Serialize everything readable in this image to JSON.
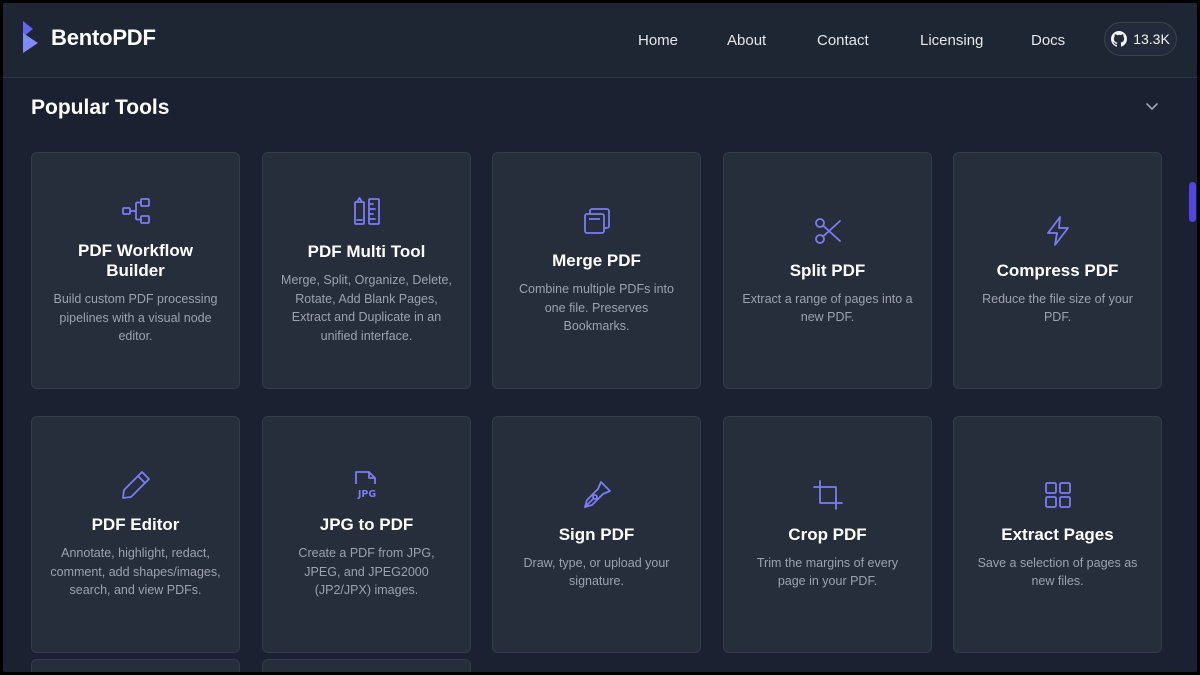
{
  "header": {
    "brand": "BentoPDF",
    "nav": [
      "Home",
      "About",
      "Contact",
      "Licensing",
      "Docs"
    ],
    "github_stars": "13.3K"
  },
  "section": {
    "title": "Popular Tools"
  },
  "tools": [
    {
      "icon": "workflow-icon",
      "title": "PDF Workflow Builder",
      "desc": "Build custom PDF processing pipelines with a visual node editor."
    },
    {
      "icon": "pencil-ruler-icon",
      "title": "PDF Multi Tool",
      "desc": "Merge, Split, Organize, Delete, Rotate, Add Blank Pages, Extract and Duplicate in an unified interface."
    },
    {
      "icon": "copy-icon",
      "title": "Merge PDF",
      "desc": "Combine multiple PDFs into one file. Preserves Bookmarks."
    },
    {
      "icon": "scissors-icon",
      "title": "Split PDF",
      "desc": "Extract a range of pages into a new PDF."
    },
    {
      "icon": "zap-icon",
      "title": "Compress PDF",
      "desc": "Reduce the file size of your PDF."
    },
    {
      "icon": "pencil-icon",
      "title": "PDF Editor",
      "desc": "Annotate, highlight, redact, comment, add shapes/images, search, and view PDFs."
    },
    {
      "icon": "jpg-file-icon",
      "title": "JPG to PDF",
      "desc": "Create a PDF from JPG, JPEG, and JPEG2000 (JP2/JPX) images.",
      "badge": "JPG"
    },
    {
      "icon": "pen-tool-icon",
      "title": "Sign PDF",
      "desc": "Draw, type, or upload your signature."
    },
    {
      "icon": "crop-icon",
      "title": "Crop PDF",
      "desc": "Trim the margins of every page in your PDF."
    },
    {
      "icon": "grid-icon",
      "title": "Extract Pages",
      "desc": "Save a selection of pages as new files."
    }
  ],
  "colors": {
    "accent": "#7c7cf5",
    "background": "#1b2130",
    "card": "#262d3b"
  }
}
